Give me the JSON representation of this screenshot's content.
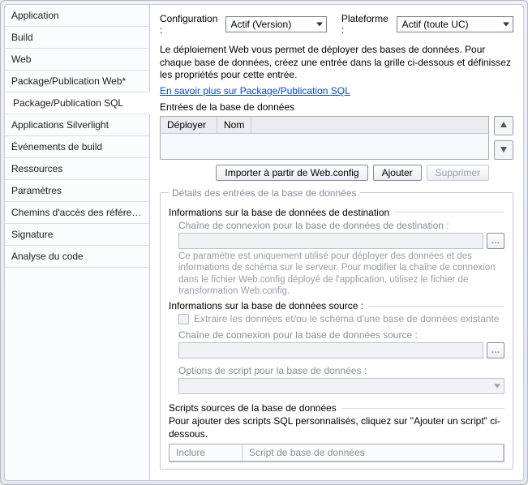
{
  "sidebar": {
    "items": [
      {
        "label": "Application"
      },
      {
        "label": "Build"
      },
      {
        "label": "Web"
      },
      {
        "label": "Package/Publication Web*"
      },
      {
        "label": "Package/Publication SQL"
      },
      {
        "label": "Applications Silverlight"
      },
      {
        "label": "Événements de build"
      },
      {
        "label": "Ressources"
      },
      {
        "label": "Paramètres"
      },
      {
        "label": "Chemins d'accès des références"
      },
      {
        "label": "Signature"
      },
      {
        "label": "Analyse du code"
      }
    ]
  },
  "top": {
    "config_label": "Configuration :",
    "config_value": "Actif (Version)",
    "platform_label": "Plateforme :",
    "platform_value": "Actif (toute UC)"
  },
  "intro": {
    "text": "Le déploiement Web vous permet de déployer des bases de données. Pour chaque base de données, créez une entrée dans la grille ci-dessous et définissez les propriétés pour cette entrée.",
    "link": "En savoir plus sur Package/Publication SQL"
  },
  "db_entries": {
    "label": "Entrées de la base de données",
    "col_deploy": "Déployer",
    "col_name": "Nom",
    "btn_import": "Importer à partir de Web.config",
    "btn_add": "Ajouter",
    "btn_remove": "Supprimer"
  },
  "details": {
    "legend": "Détails des entrées de la base de données",
    "dest_heading": "Informations sur la base de données de destination",
    "dest_conn_label": "Chaîne de connexion pour la base de données de destination :",
    "dest_hint": "Ce paramètre est uniquement utilisé pour déployer des données et des informations de schéma sur le serveur. Pour modifier la chaîne de connexion dans le fichier Web.config déployé de l'application, utilisez le fichier de transformation Web.config.",
    "src_heading": "Informations sur la base de données source :",
    "src_extract": "Extraire les données et/ou le schéma d'une base de données existante",
    "src_conn_label": "Chaîne de connexion pour la base de données source :",
    "src_options_label": "Options de script pour la base de données :",
    "scripts_heading": "Scripts sources de la base de données",
    "scripts_desc": "Pour ajouter des scripts SQL personnalisés, cliquez sur \"Ajouter un script\" ci-dessous.",
    "scripts_col_include": "Inclure",
    "scripts_col_script": "Script de base de données"
  }
}
